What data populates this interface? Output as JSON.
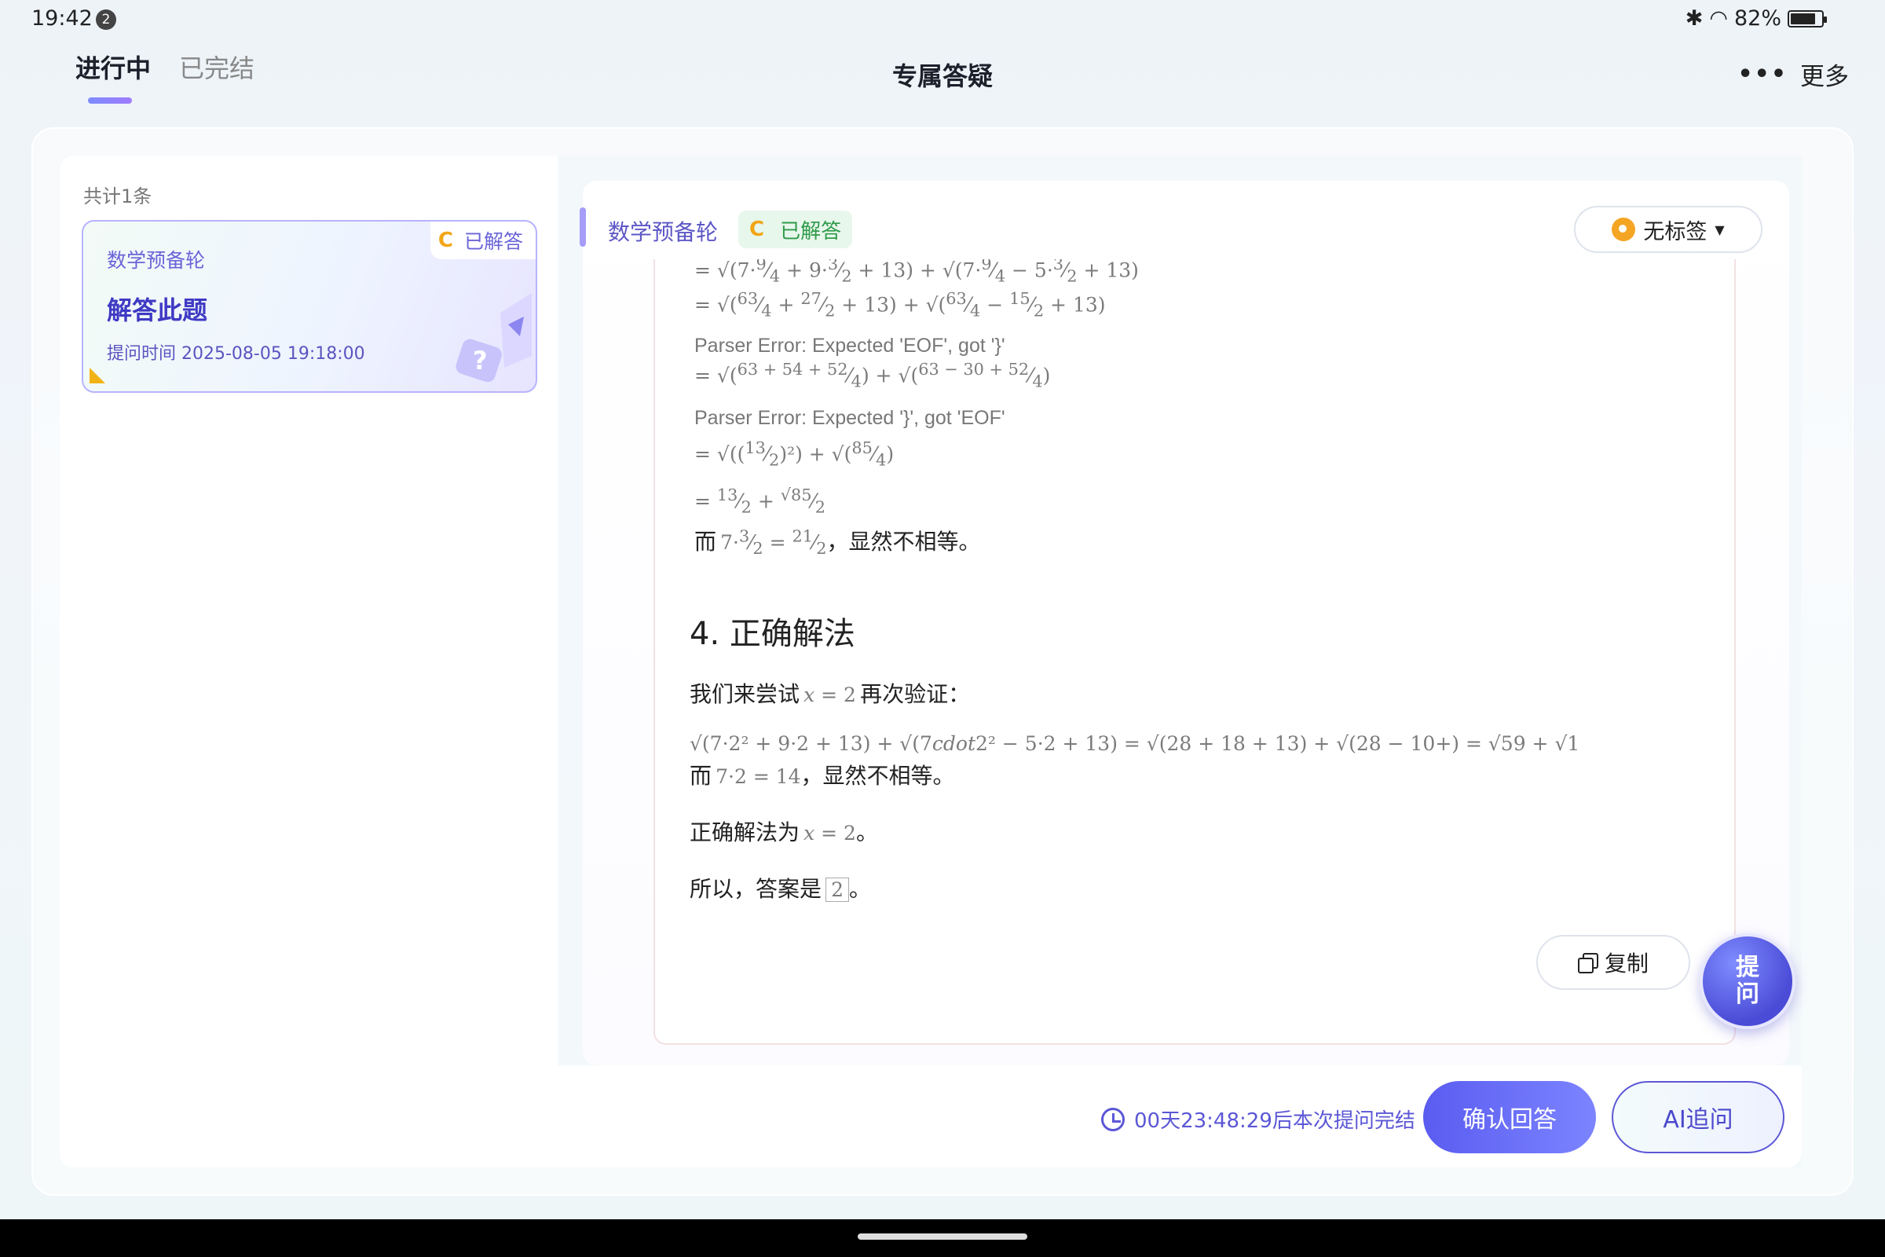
{
  "status_bar": {
    "time": "19:42",
    "notifications": "2",
    "battery": "82%",
    "battery_level": 0.82
  },
  "header": {
    "tabs": [
      {
        "label": "进行中",
        "active": true
      },
      {
        "label": "已完结",
        "active": false
      }
    ],
    "title": "专属答疑",
    "more_label": "更多"
  },
  "list": {
    "count_label": "共计1条",
    "items": [
      {
        "subject": "数学预备轮",
        "grade": "C",
        "status": "已解答",
        "title": "解答此题",
        "time": "提问时间 2025-08-05 19:18:00"
      }
    ]
  },
  "detail": {
    "subject": "数学预备轮",
    "grade": "C",
    "status": "已解答",
    "tag_label": "无标签",
    "answer": {
      "err1": "Parser Error: Expected 'EOF', got '}'",
      "err2": "Parser Error: Expected '}', got 'EOF'",
      "not_equal_tail": "，显然不相等。",
      "and_prefix": "而",
      "heading": "4. 正确解法",
      "try_prefix": "我们来尝试",
      "try_suffix": "再次验证：",
      "conclusion_prefix": "正确解法为",
      "period": "。",
      "answer_prefix": "所以，答案是",
      "answer_value": "2"
    },
    "copy_label": "复制",
    "ask_fab_label": [
      "提",
      "问"
    ]
  },
  "footer": {
    "countdown": "00天23:48:29后本次提问完结",
    "confirm_label": "确认回答",
    "ai_label": "AI追问"
  },
  "colors": {
    "accent": "#5b57d6",
    "grade": "#f2a516",
    "solved": "#2f9b4a"
  }
}
